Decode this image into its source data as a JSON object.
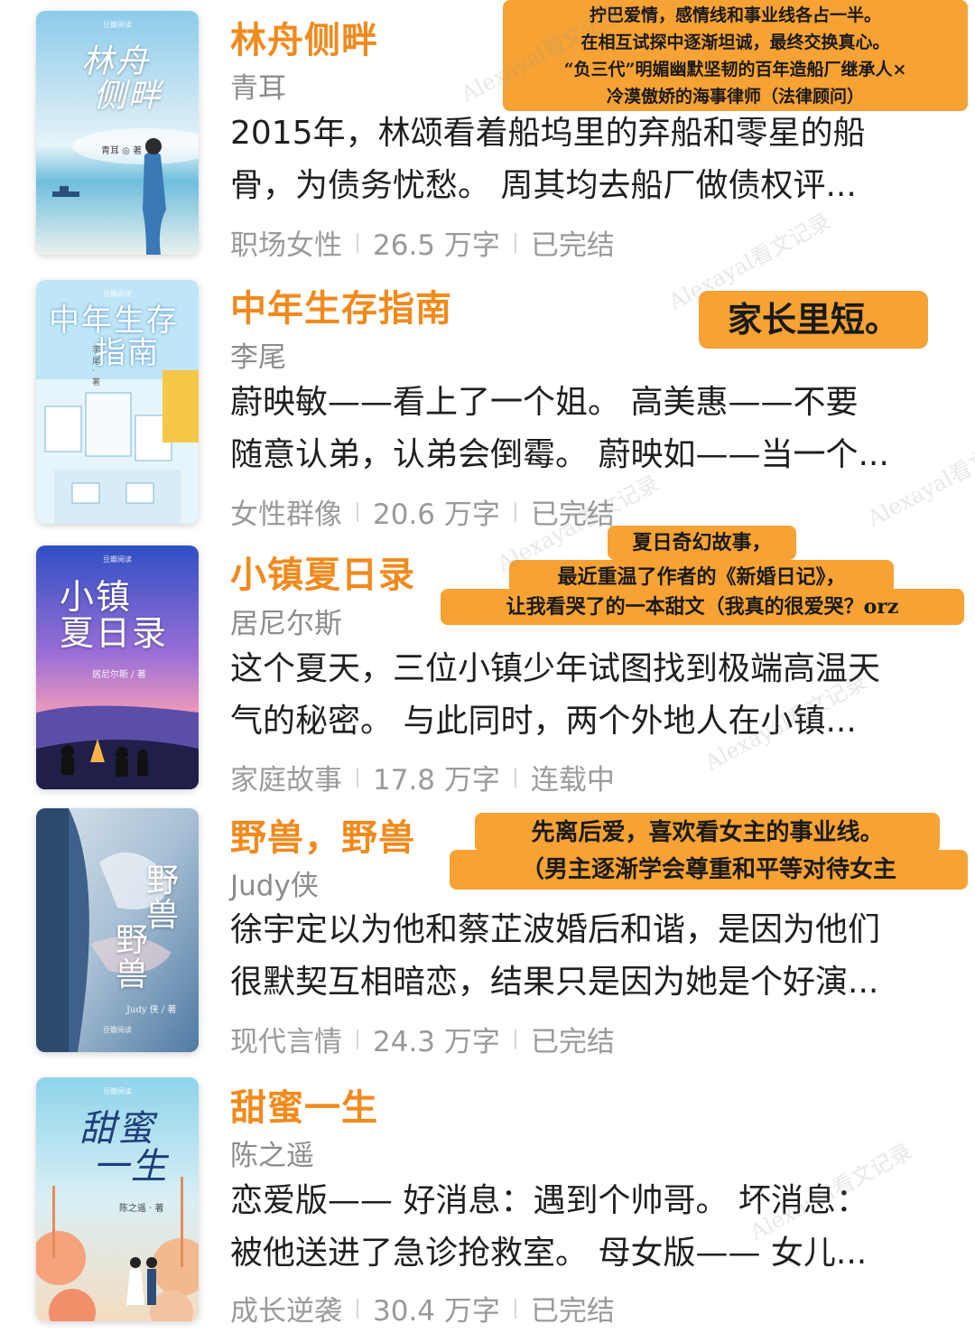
{
  "books": [
    {
      "title": "林舟侧畔",
      "author": "青耳",
      "description_line1": "2015年，林颂看着船坞里的弃船和零星的船",
      "description_line2": "骨，为债务忧愁。 周其均去船厂做债权评...",
      "genre": "职场女性",
      "words": "26.5 万字",
      "status": "已完结",
      "cover": {
        "title": "林舟\n侧畔",
        "author": "青耳 ◎ 著",
        "logo": "豆瓣阅读",
        "colors": [
          "#9ed0ec",
          "#e9f4f9",
          "#5bb6d8"
        ]
      },
      "note_lines": [
        "拧巴爱情，感情线和事业线各占一半。",
        "在相互试探中逐渐坦诚，最终交换真心。",
        "“负三代”明媚幽默坚韧的百年造船厂继承人×",
        "冷漠傲娇的海事律师（法律顾问）"
      ]
    },
    {
      "title": "中年生存指南",
      "author": "李尾",
      "description_line1": "蔚映敏——看上了一个姐。 高美惠——不要",
      "description_line2": "随意认弟，认弟会倒霉。 蔚映如——当一个...",
      "genre": "女性群像",
      "words": "20.6 万字",
      "status": "已完结",
      "cover": {
        "title": "中年生存\n指南",
        "author": "李尾 · 著",
        "logo": "豆瓣阅读",
        "colors": [
          "#6ec3ec",
          "#d8eefa",
          "#f2c94c"
        ]
      },
      "note_lines": [
        "家长里短。"
      ]
    },
    {
      "title": "小镇夏日录",
      "author": "居尼尔斯",
      "description_line1": "这个夏天，三位小镇少年试图找到极端高温天",
      "description_line2": "气的秘密。 与此同时，两个外地人在小镇...",
      "genre": "家庭故事",
      "words": "17.8 万字",
      "status": "连载中",
      "cover": {
        "title": "小镇\n夏日录",
        "author": "居尼尔斯 / 著",
        "logo": "豆瓣阅读",
        "colors": [
          "#3b57c9",
          "#9a6fd8",
          "#f08bb0"
        ]
      },
      "note_lines": [
        "夏日奇幻故事，",
        "最近重温了作者的《新婚日记》，",
        "让我看哭了的一本甜文（我真的很爱哭？orz"
      ]
    },
    {
      "title": "野兽，野兽",
      "author": "Judy侠",
      "description_line1": "徐宇定以为他和蔡芷波婚后和谐，是因为他们",
      "description_line2": "很默契互相暗恋，结果只是因为她是个好演...",
      "genre": "现代言情",
      "words": "24.3 万字",
      "status": "已完结",
      "cover": {
        "title": "野\n兽",
        "title2": "野\n兽",
        "author": "Judy 侠 / 著",
        "logo": "豆瓣阅读",
        "colors": [
          "#2e5d8a",
          "#9fb8cf",
          "#c9d7e4"
        ]
      },
      "note_lines": [
        "先离后爱，喜欢看女主的事业线。",
        "（男主逐渐学会尊重和平等对待女主"
      ]
    },
    {
      "title": "甜蜜一生",
      "author": "陈之遥",
      "description_line1": "恋爱版—— 好消息：遇到个帅哥。 坏消息：",
      "description_line2": "被他送进了急诊抢救室。 母女版—— 女儿...",
      "genre": "成长逆袭",
      "words": "30.4 万字",
      "status": "已完结",
      "cover": {
        "title": "甜蜜\n一生",
        "author": "陈之遥 · 著",
        "logo": "豆瓣阅读",
        "colors": [
          "#8fd3ea",
          "#f3e2c8",
          "#f1a47a"
        ]
      },
      "note_lines": []
    }
  ],
  "watermark": "Alexayal看文记录"
}
